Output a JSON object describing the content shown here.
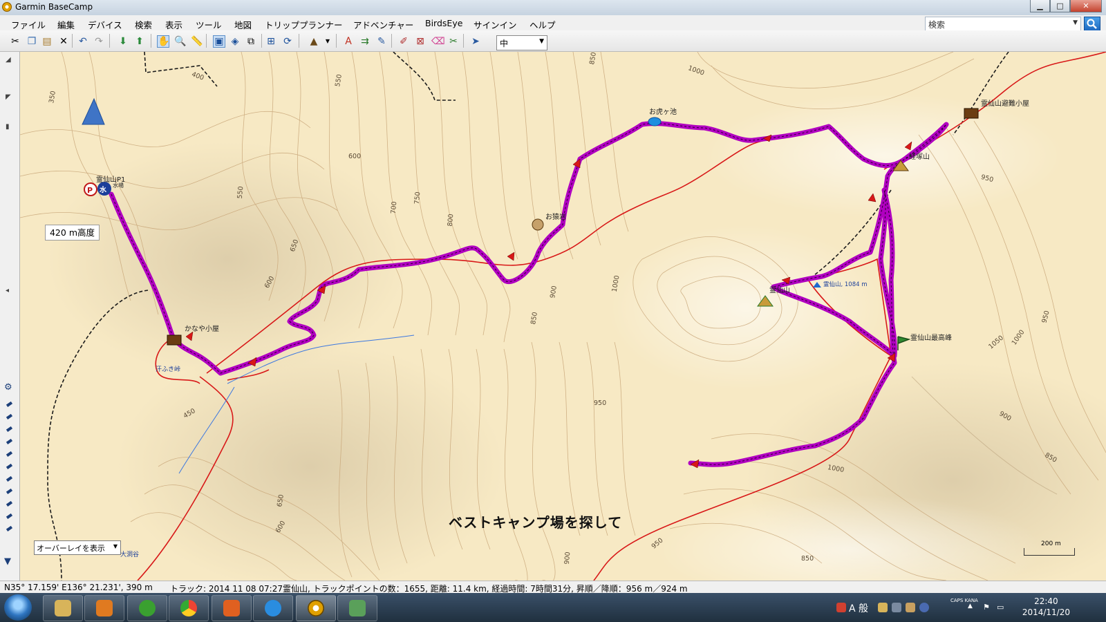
{
  "window": {
    "title": "Garmin BaseCamp",
    "btn_min": "▁",
    "btn_max": "□",
    "btn_close": "✕"
  },
  "menu": [
    "ファイル",
    "編集",
    "デバイス",
    "検索",
    "表示",
    "ツール",
    "地図",
    "トリッププランナー",
    "アドベンチャー",
    "BirdsEye",
    "サインイン",
    "ヘルプ"
  ],
  "search": {
    "placeholder": "検索"
  },
  "toolbar": {
    "zoom_value": "中"
  },
  "map": {
    "altitude_tip": "420 m高度",
    "overlay_select": "オーバーレイを表示",
    "banner": "ベストキャンプ場を探して",
    "scale_label": "200 m",
    "waypoints": {
      "parking": "霊仙山P1",
      "water": "水場",
      "kanaya": "かなや小屋",
      "asebu": "汗ふき峠",
      "okaike": "お虎ヶ池",
      "osaruiwa": "お猿岩",
      "hut": "霊仙山避難小屋",
      "kyozuka": "経塚山",
      "ryozen": "霊仙山",
      "summit_elev": "霊仙山, 1084 m",
      "highest": "霊仙山最高峰",
      "otani": "大洞谷"
    },
    "elevations": [
      "350",
      "400",
      "550",
      "600",
      "550",
      "650",
      "600",
      "700",
      "750",
      "800",
      "850",
      "1000",
      "900",
      "850",
      "1000",
      "950",
      "1050",
      "1000",
      "950",
      "900",
      "850",
      "1000",
      "950",
      "900",
      "850",
      "650",
      "600",
      "450"
    ]
  },
  "status": {
    "coords": "N35° 17.159' E136° 21.231', 390 m",
    "track": "トラック: 2014 11 08 07:27霊仙山, トラックポイントの数：1655, 距離: 11.4 km, 経過時間: 7時間31分, 昇順／降順：956 m／924 m"
  },
  "taskbar": {
    "time": "22:40",
    "date": "2014/11/20",
    "ime": "A 般",
    "caps": "CAPS KANA"
  },
  "colors": {
    "track": "#b000c0",
    "trail": "#d81818",
    "water": "#3c78e0",
    "map_bg": "#f7e9c4"
  }
}
